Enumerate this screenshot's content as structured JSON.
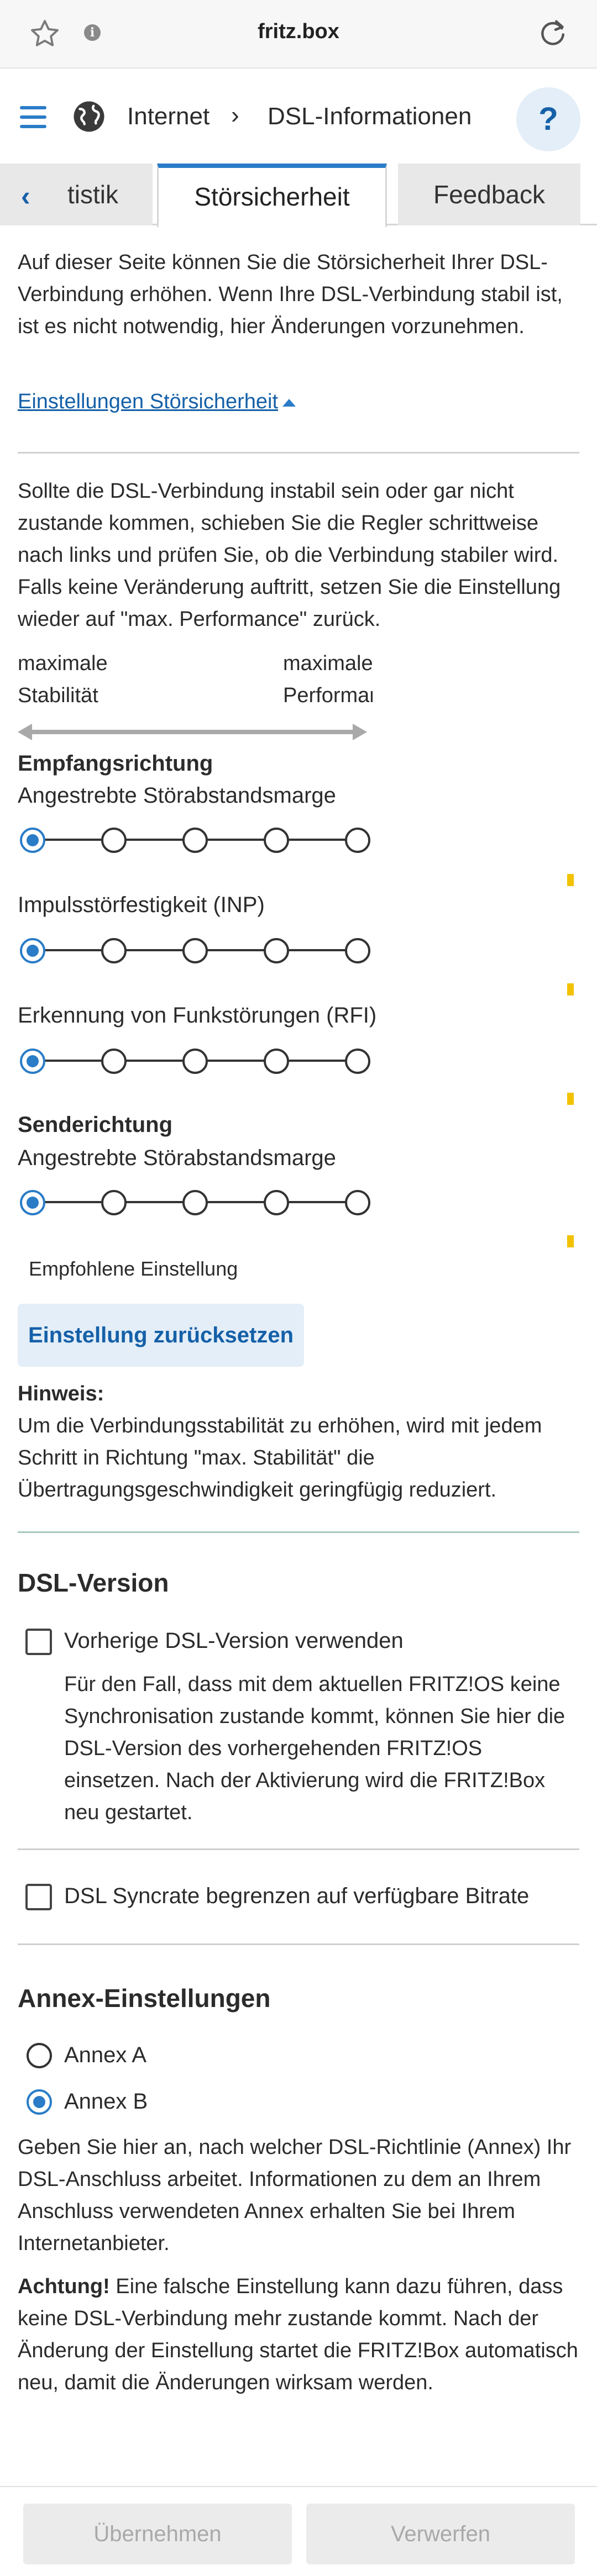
{
  "browser": {
    "url": "fritz.box",
    "info_glyph": "i"
  },
  "nav": {
    "breadcrumb": [
      "Internet",
      "DSL-Informationen"
    ],
    "separator": "›",
    "help_label": "?"
  },
  "tabs": {
    "back_glyph": "‹",
    "items": [
      {
        "label": "tistik"
      },
      {
        "label": "Störsicherheit",
        "active": true
      },
      {
        "label": "Feedback"
      }
    ]
  },
  "intro": "Auf dieser Seite können Sie die Störsicherheit Ihrer DSL-Verbindung erhöhen. Wenn Ihre DSL-Verbindung stabil ist, ist es nicht notwendig, hier Änderungen vorzunehmen.",
  "settings_link": "Einstellungen Störsicherheit",
  "instructions": "Sollte die DSL-Verbindung instabil sein oder gar nicht zustande kommen, schieben Sie die Regler schrittweise nach links und prüfen Sie, ob die Verbindung stabiler wird. Falls keine Veränderung auftritt, setzen Sie die Einstellung wieder auf \"max. Performance\" zurück.",
  "scale": {
    "left_line1": "maximale",
    "left_line2": "Stabilität",
    "right_line1": "maximale",
    "right_line2": "Performance"
  },
  "receive": {
    "heading": "Empfangsrichtung",
    "snr_label": "Angestrebte Störabstandsmarge",
    "snr_level": 1,
    "inp_label": "Impulsstörfestigkeit (INP)",
    "inp_level": 1,
    "rfi_label": "Erkennung von Funkstörungen (RFI)",
    "rfi_level": 1
  },
  "send": {
    "heading": "Senderichtung",
    "snr_label": "Angestrebte Störabstandsmarge",
    "snr_level": 1
  },
  "slider_steps": 5,
  "recommended_label": "Empfohlene Einstellung",
  "reset_button": "Einstellung zurücksetzen",
  "hint": {
    "title": "Hinweis:",
    "text": "Um die Verbindungsstabilität zu erhöhen, wird mit jedem Schritt in Richtung \"max. Stabilität\" die Übertragungsgeschwindigkeit geringfügig reduziert."
  },
  "dsl_version": {
    "heading": "DSL-Version",
    "checkbox_label": "Vorherige DSL-Version verwenden",
    "checked": false,
    "description": "Für den Fall, dass mit dem aktuellen FRITZ!OS keine Synchronisation zustande kommt, können Sie hier die DSL-Version des vorhergehenden FRITZ!OS einsetzen. Nach der Aktivierung wird die FRITZ!Box neu gestartet."
  },
  "syncrate": {
    "checkbox_label": "DSL Syncrate begrenzen auf verfügbare Bitrate",
    "checked": false
  },
  "annex": {
    "heading": "Annex-Einstellungen",
    "options": [
      {
        "label": "Annex A",
        "selected": false
      },
      {
        "label": "Annex B",
        "selected": true
      }
    ],
    "description": "Geben Sie hier an, nach welcher DSL-Richtlinie (Annex) Ihr DSL-Anschluss arbeitet. Informationen zu dem an Ihrem Anschluss verwendeten Annex erhalten Sie bei Ihrem Internetanbieter.",
    "warning_bold": "Achtung!",
    "warning_text": " Eine falsche Einstellung kann dazu führen, dass keine DSL-Verbindung mehr zustande kommt. Nach der Änderung der Einstellung startet die FRITZ!Box automatisch neu, damit die Änderungen wirksam werden."
  },
  "footer": {
    "apply": "Übernehmen",
    "discard": "Verwerfen"
  },
  "colors": {
    "accent": "#2a7cc7",
    "link": "#1560a8",
    "marker": "#f2c200",
    "button_bg": "#e3eef8"
  }
}
